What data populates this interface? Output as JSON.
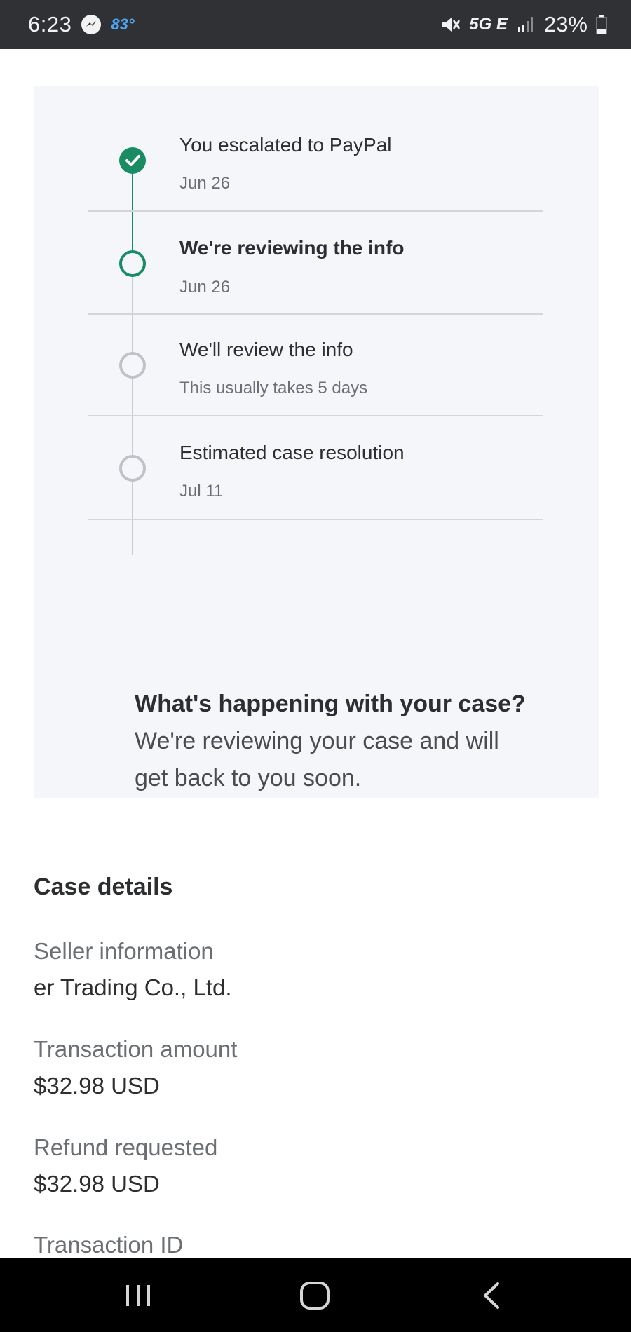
{
  "status_bar": {
    "time": "6:23",
    "temperature": "83°",
    "network": "5G E",
    "battery": "23%",
    "icons": [
      "messenger-icon",
      "mute-icon",
      "signal-icon",
      "battery-icon"
    ]
  },
  "timeline": {
    "steps": [
      {
        "title": "You escalated to PayPal",
        "subtitle": "Jun 26",
        "state": "done"
      },
      {
        "title": "We're reviewing the info",
        "subtitle": "Jun 26",
        "state": "current"
      },
      {
        "title": "We'll review the info",
        "subtitle": "This usually takes 5 days",
        "state": "pending"
      },
      {
        "title": "Estimated case resolution",
        "subtitle": "Jul 11",
        "state": "pending"
      }
    ]
  },
  "happening": {
    "title": "What's happening with your case?",
    "body": "We're reviewing your case and will get back to you soon."
  },
  "case_details": {
    "title": "Case details",
    "seller_label": "Seller information",
    "seller_value": "er Trading Co., Ltd.",
    "amount_label": "Transaction amount",
    "amount_value": "$32.98 USD",
    "refund_label": "Refund requested",
    "refund_value": "$32.98 USD",
    "txid_label": "Transaction ID"
  },
  "colors": {
    "accent_green": "#1a8c64",
    "card_bg": "#f5f6fa",
    "status_bar": "#2f3135"
  },
  "nav_bar": {
    "icons": [
      "recent-apps-icon",
      "home-icon",
      "back-icon"
    ]
  }
}
